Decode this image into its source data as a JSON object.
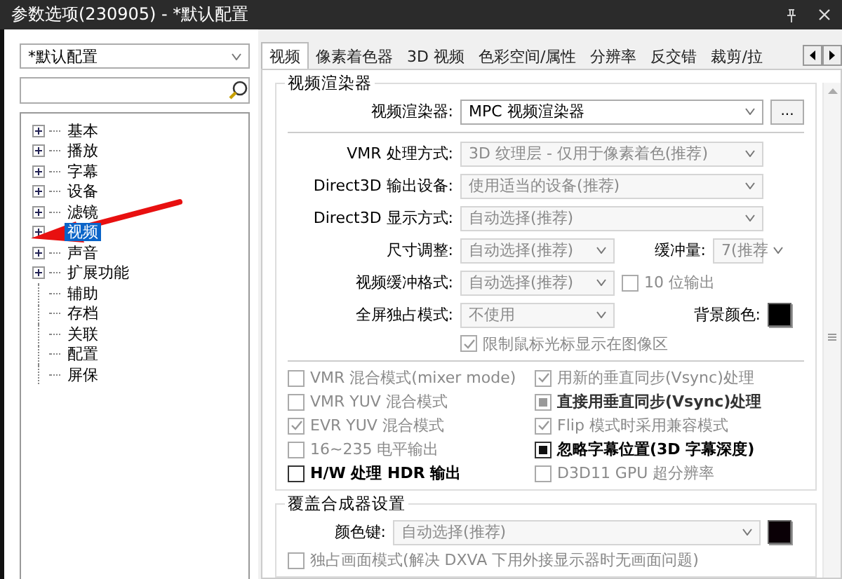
{
  "window": {
    "title": "参数选项(230905) - *默认配置"
  },
  "profile_select": {
    "value": "*默认配置"
  },
  "tree": [
    {
      "label": "基本",
      "kind": "folder",
      "selected": false
    },
    {
      "label": "播放",
      "kind": "folder",
      "selected": false
    },
    {
      "label": "字幕",
      "kind": "folder",
      "selected": false
    },
    {
      "label": "设备",
      "kind": "folder",
      "selected": false
    },
    {
      "label": "滤镜",
      "kind": "folder",
      "selected": false
    },
    {
      "label": "视频",
      "kind": "folder",
      "selected": true
    },
    {
      "label": "声音",
      "kind": "folder",
      "selected": false
    },
    {
      "label": "扩展功能",
      "kind": "folder",
      "selected": false
    },
    {
      "label": "辅助",
      "kind": "leaf",
      "selected": false
    },
    {
      "label": "存档",
      "kind": "leaf",
      "selected": false
    },
    {
      "label": "关联",
      "kind": "leaf",
      "selected": false
    },
    {
      "label": "配置",
      "kind": "leaf",
      "selected": false
    },
    {
      "label": "屏保",
      "kind": "leaf",
      "selected": false
    }
  ],
  "tabs": [
    {
      "label": "视频",
      "selected": true
    },
    {
      "label": "像素着色器",
      "selected": false
    },
    {
      "label": "3D 视频",
      "selected": false
    },
    {
      "label": "色彩空间/属性",
      "selected": false
    },
    {
      "label": "分辨率",
      "selected": false
    },
    {
      "label": "反交错",
      "selected": false
    },
    {
      "label": "裁剪/拉",
      "selected": false
    }
  ],
  "renderer_group": {
    "title": "视频渲染器",
    "renderer": {
      "label": "视频渲染器:",
      "value": "MPC 视频渲染器",
      "button": "..."
    },
    "rows": [
      {
        "label": "VMR 处理方式:",
        "value": "3D 纹理层 - 仅用于像素着色(推荐)",
        "disabled": true
      },
      {
        "label": "Direct3D 输出设备:",
        "value": "使用适当的设备(推荐)",
        "disabled": true
      },
      {
        "label": "Direct3D 显示方式:",
        "value": "自动选择(推荐)",
        "disabled": true
      }
    ],
    "resize": {
      "label": "尺寸调整:",
      "value": "自动选择(推荐)",
      "disabled": true
    },
    "buffer": {
      "label": "缓冲量:",
      "value": "7(推荐",
      "disabled": true
    },
    "buffer_format": {
      "label": "视频缓冲格式:",
      "value": "自动选择(推荐)",
      "disabled": true
    },
    "ten_bit": {
      "label": "10 位输出",
      "checked": false,
      "disabled": true
    },
    "fullscreen": {
      "label": "全屏独占模式:",
      "value": "不使用",
      "disabled": true
    },
    "background": {
      "label": "背景颜色:",
      "color": "#000000"
    },
    "limit_cursor": {
      "label": "限制鼠标光标显示在图像区",
      "checked": true,
      "disabled": true
    },
    "options": [
      {
        "label": "VMR 混合模式(mixer mode)",
        "kind": "check",
        "checked": false,
        "disabled": true,
        "bold": false
      },
      {
        "label": "用新的垂直同步(Vsync)处理",
        "kind": "check",
        "checked": true,
        "disabled": true,
        "bold": false
      },
      {
        "label": "VMR YUV 混合模式",
        "kind": "check",
        "checked": false,
        "disabled": true,
        "bold": false
      },
      {
        "label": "直接用垂直同步(Vsync)处理",
        "kind": "tristate",
        "checked": true,
        "disabled": true,
        "bold": true
      },
      {
        "label": "EVR YUV 混合模式",
        "kind": "check",
        "checked": true,
        "disabled": true,
        "bold": false
      },
      {
        "label": "Flip 模式时采用兼容模式",
        "kind": "check",
        "checked": true,
        "disabled": true,
        "bold": false
      },
      {
        "label": "16~235 电平输出",
        "kind": "check",
        "checked": false,
        "disabled": true,
        "bold": false
      },
      {
        "label": "忽略字幕位置(3D 字幕深度)",
        "kind": "tristate",
        "checked": true,
        "disabled": false,
        "bold": true
      },
      {
        "label": "H/W 处理 HDR 输出",
        "kind": "tristate",
        "checked": false,
        "disabled": false,
        "bold": true
      },
      {
        "label": "D3D11 GPU 超分辨率",
        "kind": "check",
        "checked": false,
        "disabled": true,
        "bold": false
      }
    ]
  },
  "overlay_group": {
    "title": "覆盖合成器设置",
    "color_key": {
      "label": "颜色键:",
      "value": "自动选择(推荐)",
      "color": "#0a0006",
      "disabled": true
    },
    "exclusive": {
      "label": "独占画面模式(解决 DXVA 下用外接显示器时无画面问题)",
      "checked": false,
      "disabled": true
    }
  }
}
